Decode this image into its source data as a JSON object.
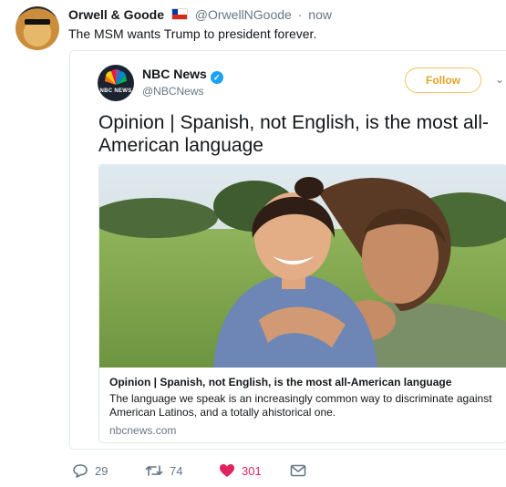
{
  "tweet": {
    "display_name": "Orwell & Goode",
    "handle": "@OrwellNGoode",
    "separator": "·",
    "time": "now",
    "text": "The MSM wants Trump to president forever."
  },
  "quoted": {
    "name": "NBC News",
    "handle": "@NBCNews",
    "logo_text": "NBC NEWS",
    "follow_label": "Follow",
    "headline": "Opinion | Spanish, not English, is the most all-American language",
    "card": {
      "title": "Opinion | Spanish, not English, is the most all-American language",
      "description": "The language we speak is an increasingly common way to discriminate against American Latinos, and a totally ahistorical one.",
      "domain": "nbcnews.com"
    }
  },
  "actions": {
    "replies": "29",
    "retweets": "74",
    "likes": "301"
  },
  "colors": {
    "accent": "#1da1f2",
    "like": "#e0245e",
    "follow": "#e0a526",
    "muted": "#657786"
  }
}
